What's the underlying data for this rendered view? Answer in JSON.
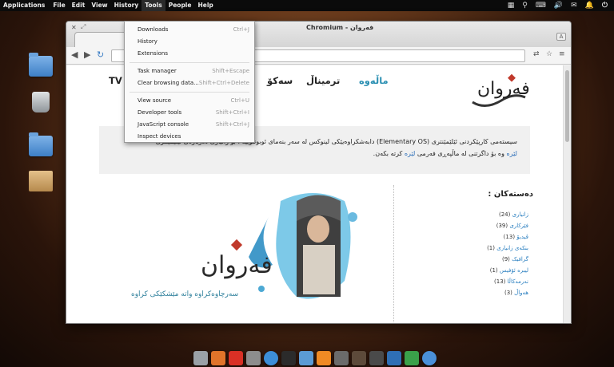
{
  "panel": {
    "menus": [
      "Applications",
      "File",
      "Edit",
      "View",
      "History",
      "Tools",
      "People",
      "Help"
    ],
    "active_menu": "Tools",
    "tray_icons": [
      "calendar-icon",
      "search-icon",
      "keyboard-icon",
      "volume-icon",
      "mail-icon",
      "notifications-icon",
      "power-icon"
    ]
  },
  "window": {
    "title": "Chromium - فەروان",
    "user_button": "A"
  },
  "tools_menu": {
    "items": [
      {
        "label": "Downloads",
        "shortcut": "Ctrl+J"
      },
      {
        "label": "History",
        "shortcut": ""
      },
      {
        "label": "Extensions",
        "shortcut": ""
      },
      {
        "separator": true
      },
      {
        "label": "Task manager",
        "shortcut": "Shift+Escape"
      },
      {
        "label": "Clear browsing data...",
        "shortcut": "Shift+Ctrl+Delete"
      },
      {
        "separator": true
      },
      {
        "label": "View source",
        "shortcut": "Ctrl+U"
      },
      {
        "label": "Developer tools",
        "shortcut": "Shift+Ctrl+I"
      },
      {
        "label": "JavaScript console",
        "shortcut": "Shift+Ctrl+J"
      },
      {
        "label": "Inspect devices",
        "shortcut": ""
      }
    ]
  },
  "site": {
    "nav": [
      "ماڵەوە",
      "ترمیناڵ",
      "سەکۆ",
      "TV"
    ],
    "logo_text": "فەروان",
    "intro_line1": "سیستەمی کارپێکردنی ئێلێمێنتری (Elementary OS) دابەشکراوەیێکی لینوکس لە سەر بنەمای ئوبونتوییە . بۆ زانیاری دەربارەی ئێلێمێنتری",
    "intro_link": "لێرە",
    "intro_line2": "وە بۆ داگرتنی لە ماڵپەڕی فەرمی",
    "intro_link2": "لێرە",
    "intro_line2_end": "کرتە بکەن.",
    "categories_title": "دەستەکان :",
    "categories": [
      {
        "name": "زانیاری",
        "count": "(24)"
      },
      {
        "name": "فێرکاری",
        "count": "(39)"
      },
      {
        "name": "ڤیدیۆ",
        "count": "(13)"
      },
      {
        "name": "بنکەی زانیاری",
        "count": "(1)"
      },
      {
        "name": "گرافیک",
        "count": "(9)"
      },
      {
        "name": "لیبرە ئۆفیس",
        "count": "(1)"
      },
      {
        "name": "نەرمەکاڵا",
        "count": "(13)"
      },
      {
        "name": "هەواڵ",
        "count": "(3)"
      }
    ],
    "hero_caption": "سەرچاوەکراوە واتە مێشکێکی کراوە",
    "hero_logo": "فەروان"
  }
}
